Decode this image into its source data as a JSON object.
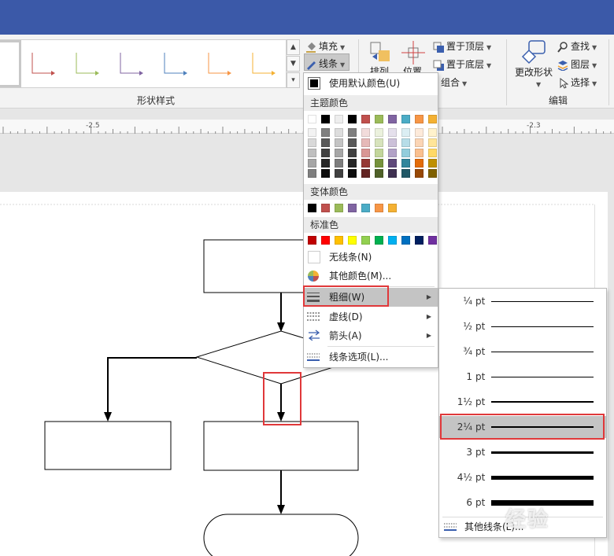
{
  "ribbon": {
    "fill_label": "填充",
    "line_label": "线条",
    "arrange_label": "排列",
    "position_label": "位置",
    "bring_front_label": "置于顶层",
    "send_back_label": "置于底层",
    "group_label": "组合",
    "change_shape_label": "更改形状",
    "find_label": "查找",
    "layers_label": "图层",
    "select_label": "选择",
    "shape_styles_group": "形状样式",
    "editing_group": "编辑",
    "gallery_colors": [
      "#333333",
      "#c0504d",
      "#9bbb59",
      "#8064a2",
      "#4f81bd",
      "#f79646",
      "#f4b133"
    ]
  },
  "ruler": {
    "left_label": "-2.5",
    "right_label": "-2.3"
  },
  "line_menu": {
    "default_color_label": "使用默认颜色(U)",
    "theme_colors_header": "主题颜色",
    "theme_colors_top": [
      "#ffffff",
      "#000000",
      "#eeeeee",
      "#000000",
      "#c0504d",
      "#9bbb59",
      "#8064a2",
      "#4bacc6",
      "#f79646",
      "#f4b133"
    ],
    "theme_colors_shades": [
      [
        "#f2f2f2",
        "#d9d9d9",
        "#bfbfbf",
        "#a6a6a6",
        "#7f7f7f"
      ],
      [
        "#7f7f7f",
        "#595959",
        "#404040",
        "#262626",
        "#0d0d0d"
      ],
      [
        "#dddddd",
        "#c4c4c4",
        "#a6a6a6",
        "#7d7d7d",
        "#404040"
      ],
      [
        "#7f7f7f",
        "#595959",
        "#404040",
        "#262626",
        "#0d0d0d"
      ],
      [
        "#f2dcdb",
        "#e6b9b8",
        "#d99694",
        "#953734",
        "#632423"
      ],
      [
        "#ebf1dd",
        "#d7e3bc",
        "#c3d69b",
        "#76923c",
        "#4f6128"
      ],
      [
        "#e5e0ec",
        "#ccc1d9",
        "#b2a2c7",
        "#5f497a",
        "#3f3151"
      ],
      [
        "#dbeef3",
        "#b7dde8",
        "#92cddc",
        "#31859b",
        "#205867"
      ],
      [
        "#fdeada",
        "#fbd5b5",
        "#fac08f",
        "#e36c09",
        "#974806"
      ],
      [
        "#fff2cc",
        "#ffe599",
        "#ffd966",
        "#bf9000",
        "#7f6000"
      ]
    ],
    "variant_colors_header": "变体颜色",
    "variant_colors": [
      "#000000",
      "#c0504d",
      "#9bbb59",
      "#8064a2",
      "#4bacc6",
      "#f79646",
      "#f4b133"
    ],
    "standard_colors_header": "标准色",
    "standard_colors": [
      "#c00000",
      "#ff0000",
      "#ffc000",
      "#ffff00",
      "#92d050",
      "#00b050",
      "#00b0f0",
      "#0070c0",
      "#002060",
      "#7030a0"
    ],
    "no_line_label": "无线条(N)",
    "more_colors_label": "其他颜色(M)...",
    "weight_label": "粗细(W)",
    "dash_label": "虚线(D)",
    "arrow_label": "箭头(A)",
    "line_options_label": "线条选项(L)..."
  },
  "weight_menu": {
    "items": [
      {
        "label": "¼",
        "unit": "pt",
        "weight": 0.25
      },
      {
        "label": "½",
        "unit": "pt",
        "weight": 0.5
      },
      {
        "label": "¾",
        "unit": "pt",
        "weight": 0.75
      },
      {
        "label": "1",
        "unit": "pt",
        "weight": 1
      },
      {
        "label": "1½",
        "unit": "pt",
        "weight": 1.5
      },
      {
        "label": "2¼",
        "unit": "pt",
        "weight": 2.25,
        "selected": true
      },
      {
        "label": "3",
        "unit": "pt",
        "weight": 3
      },
      {
        "label": "4½",
        "unit": "pt",
        "weight": 4.5
      },
      {
        "label": "6",
        "unit": "pt",
        "weight": 6
      }
    ],
    "more_lines_label": "其他线条(L)..."
  },
  "watermark": "经验"
}
